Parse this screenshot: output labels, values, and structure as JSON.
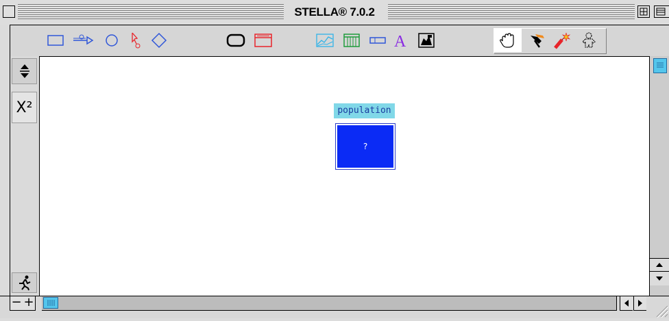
{
  "window": {
    "title": "STELLA® 7.0.2"
  },
  "toolbar": {
    "building_blocks": [
      "stock",
      "flow",
      "converter",
      "connector",
      "decision-process-diamond"
    ],
    "objects": [
      "sector-frame",
      "button"
    ],
    "output": [
      "graph",
      "table",
      "numeric-display",
      "text-annotation",
      "picture"
    ],
    "tools": [
      "hand",
      "paintbrush",
      "dynamite",
      "ghost"
    ],
    "selected_tool": "hand"
  },
  "left_panel": {
    "formula_button": "X²"
  },
  "model": {
    "stock": {
      "name": "population",
      "value": "?"
    }
  },
  "colors": {
    "stock_fill": "#0b2bf5",
    "stock_label_bg": "#81d8e8",
    "scroll_thumb": "#54c6ec",
    "tool_blue": "#2f56d8",
    "tool_red": "#e8242a",
    "tool_purple": "#8a2be2"
  },
  "bottom_bar": {
    "zoom_out": "−",
    "zoom_in": "+"
  }
}
